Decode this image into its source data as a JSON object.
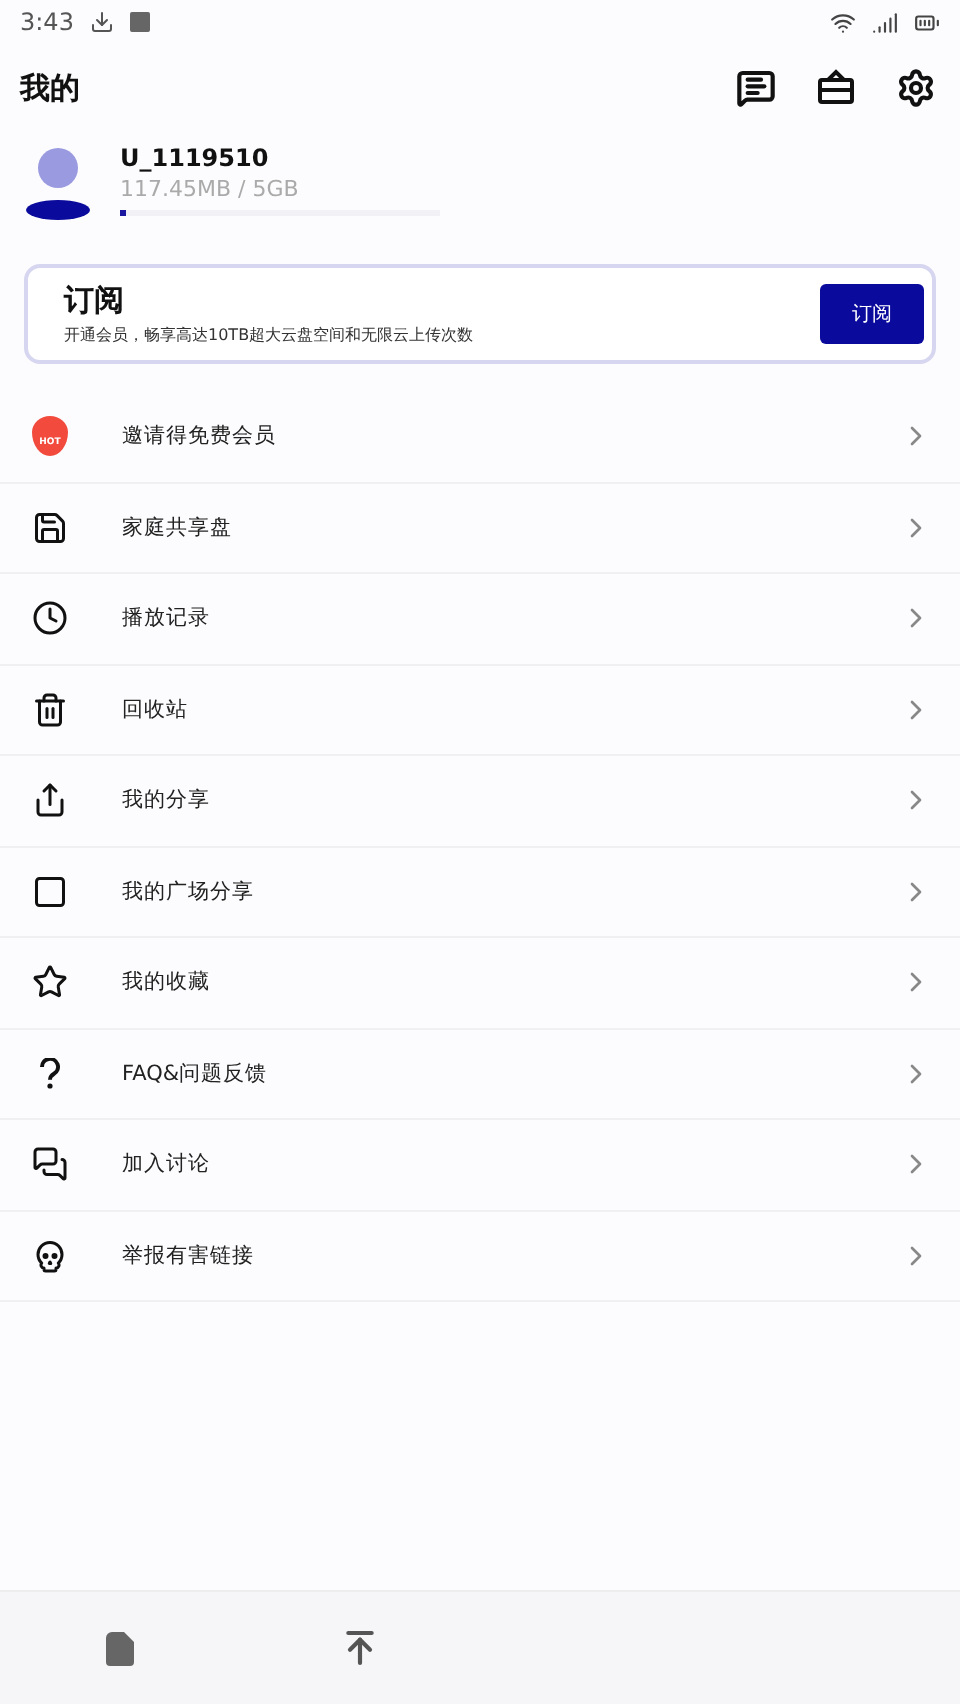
{
  "status_bar": {
    "time": "3:43"
  },
  "header": {
    "title": "我的"
  },
  "profile": {
    "username": "U_1119510",
    "storage": "117.45MB / 5GB",
    "level": 0.02
  },
  "subscription": {
    "title": "订阅",
    "description": "开通会员，畅享高达10TB超大云盘空间和无限云上传次数",
    "button": "订阅"
  },
  "menu": [
    {
      "kind": "hot",
      "badge": "HOT",
      "label": "邀请得免费会员"
    },
    {
      "kind": "disk",
      "label": "家庭共享盘"
    },
    {
      "kind": "history",
      "label": "播放记录"
    },
    {
      "kind": "trash",
      "label": "回收站"
    },
    {
      "kind": "share",
      "label": "我的分享"
    },
    {
      "kind": "square",
      "label": "我的广场分享"
    },
    {
      "kind": "star",
      "label": "我的收藏"
    },
    {
      "kind": "faq",
      "label": "FAQ&问题反馈"
    },
    {
      "kind": "chat",
      "label": "加入讨论"
    },
    {
      "kind": "skull",
      "label": "举报有害链接"
    }
  ],
  "bottom_nav": [
    {
      "kind": "file"
    },
    {
      "kind": "upload"
    }
  ]
}
